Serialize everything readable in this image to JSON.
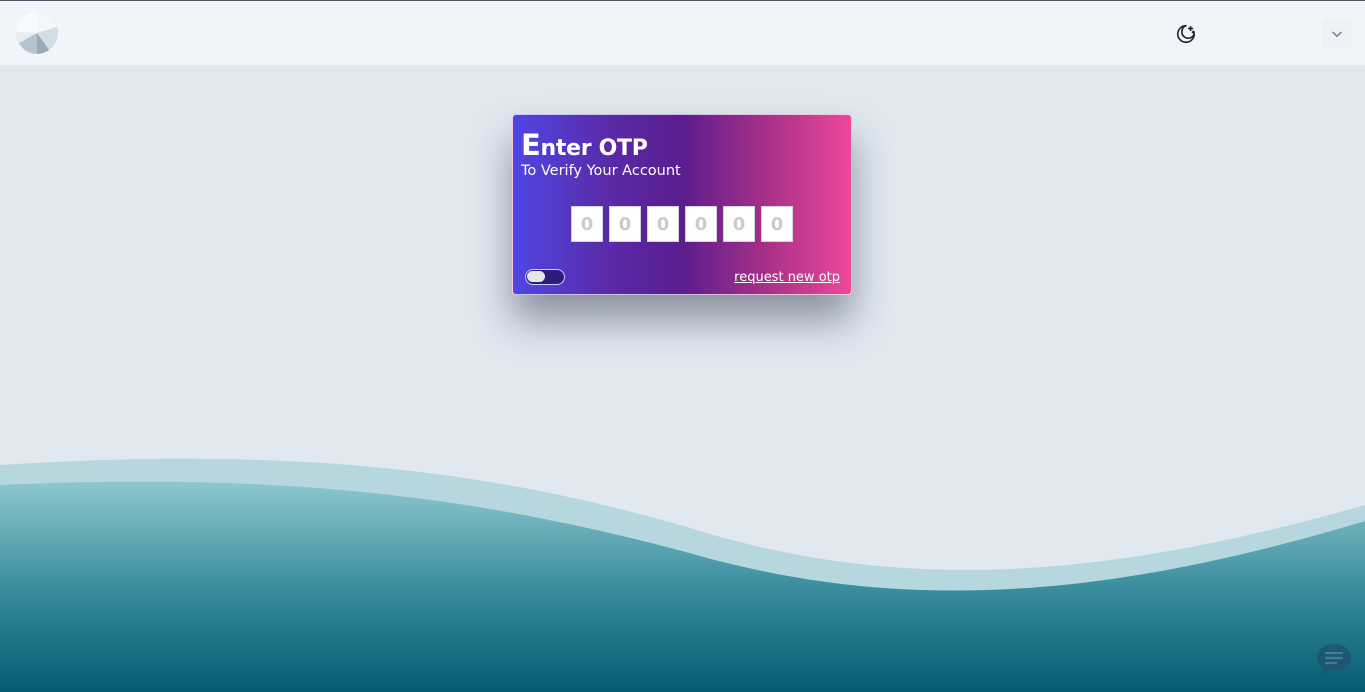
{
  "header": {
    "logo_icon": "pie-logo-icon",
    "theme_icon": "moon-stars-icon",
    "menu_icon": "chevron-down-icon"
  },
  "otp_card": {
    "title_first_letter": "E",
    "title_rest": "nter OTP",
    "subtitle": "To Verify Your Account",
    "digit_placeholders": [
      "0",
      "0",
      "0",
      "0",
      "0",
      "0"
    ],
    "request_link": "request new otp"
  },
  "chat": {
    "icon": "chat-bubble-icon"
  },
  "colors": {
    "card_gradient_start": "#4f46e5",
    "card_gradient_mid": "#5b1d8f",
    "card_gradient_end": "#ec4899",
    "wave_top": "#8fc7cf",
    "wave_bottom": "#055a72",
    "background": "#e2e8f0"
  }
}
